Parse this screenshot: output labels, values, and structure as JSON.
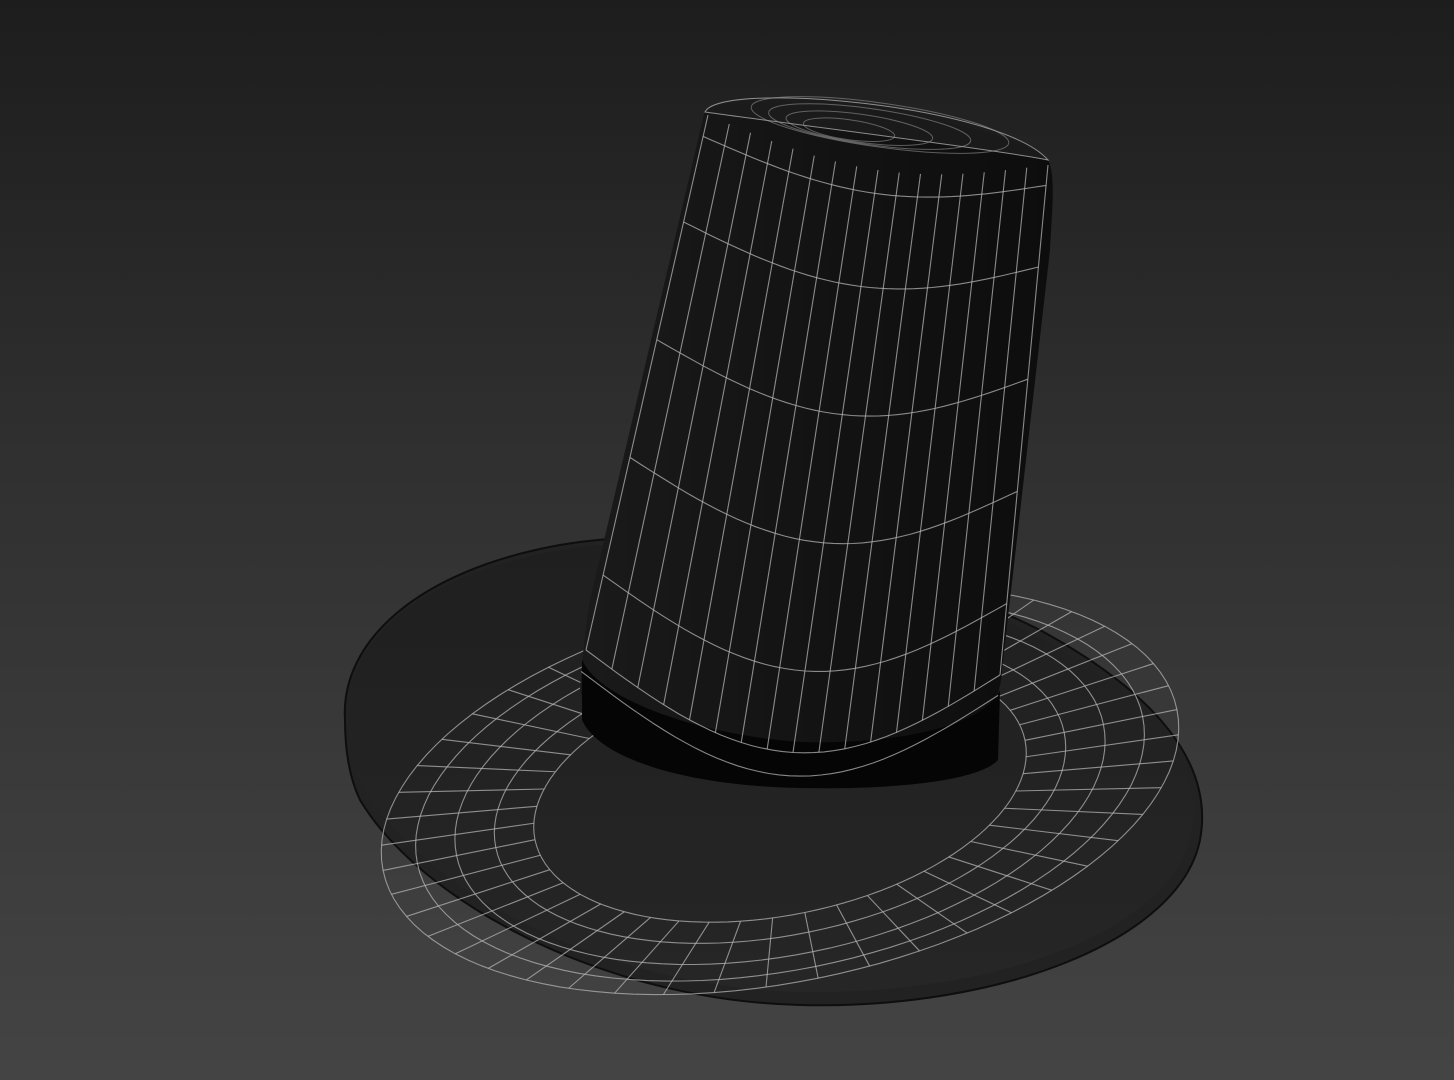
{
  "viewport": {
    "background_top": "#1d1d1d",
    "background_bottom": "#444444"
  },
  "model": {
    "subject": "top-hat-wireframe",
    "shading": "dark",
    "wireframe_color": "#b4b4b4",
    "surface_color": "#161616",
    "band_color": "#050505"
  }
}
